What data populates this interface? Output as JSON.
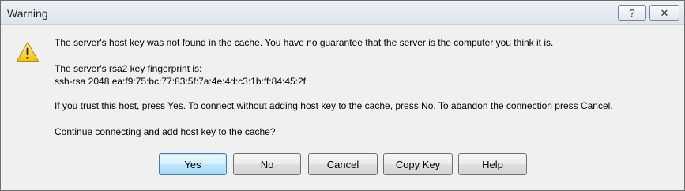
{
  "window": {
    "title": "Warning"
  },
  "titlebar": {
    "help_glyph": "?",
    "close_glyph": "✕"
  },
  "icon": {
    "name": "warning-icon",
    "color": "#f2c200"
  },
  "message": {
    "line1": "The server's host key was not found in the cache. You have no guarantee that the server is the computer you think it is.",
    "fingerprint_label": "The server's rsa2 key fingerprint is:",
    "fingerprint": "ssh-rsa 2048 ea:f9:75:bc:77:83:5f:7a:4e:4d:c3:1b:ff:84:45:2f",
    "instructions": "If you trust this host, press Yes. To connect without adding host key to the cache, press No. To abandon the connection press Cancel.",
    "question": "Continue connecting and add host key to the cache?"
  },
  "buttons": {
    "yes": "Yes",
    "no": "No",
    "cancel": "Cancel",
    "copy_key": "Copy Key",
    "help": "Help"
  }
}
